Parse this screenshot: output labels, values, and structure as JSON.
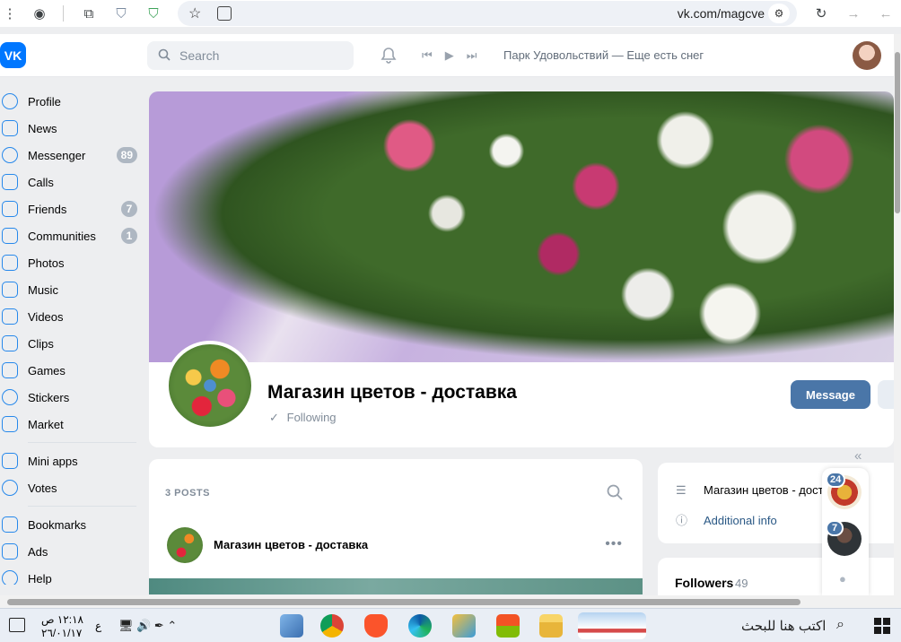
{
  "browser": {
    "url": "vk.com/magcve"
  },
  "header": {
    "logo_text": "VK",
    "search_placeholder": "Search",
    "now_playing": "Парк Удовольствий — Еще есть снег"
  },
  "sidebar": {
    "items": [
      {
        "label": "Profile",
        "icon": "profile-icon",
        "count": ""
      },
      {
        "label": "News",
        "icon": "news-icon",
        "count": ""
      },
      {
        "label": "Messenger",
        "icon": "messenger-icon",
        "count": "89"
      },
      {
        "label": "Calls",
        "icon": "calls-icon",
        "count": ""
      },
      {
        "label": "Friends",
        "icon": "friends-icon",
        "count": "7"
      },
      {
        "label": "Communities",
        "icon": "communities-icon",
        "count": "1"
      },
      {
        "label": "Photos",
        "icon": "photos-icon",
        "count": ""
      },
      {
        "label": "Music",
        "icon": "music-icon",
        "count": ""
      },
      {
        "label": "Videos",
        "icon": "videos-icon",
        "count": ""
      },
      {
        "label": "Clips",
        "icon": "clips-icon",
        "count": ""
      },
      {
        "label": "Games",
        "icon": "games-icon",
        "count": ""
      },
      {
        "label": "Stickers",
        "icon": "stickers-icon",
        "count": ""
      },
      {
        "label": "Market",
        "icon": "market-icon",
        "count": ""
      }
    ],
    "items2": [
      {
        "label": "Mini apps",
        "icon": "mini-apps-icon"
      },
      {
        "label": "Votes",
        "icon": "votes-icon"
      }
    ],
    "items3": [
      {
        "label": "Bookmarks",
        "icon": "bookmarks-icon"
      },
      {
        "label": "Ads",
        "icon": "ads-icon"
      },
      {
        "label": "Help",
        "icon": "help-icon"
      }
    ]
  },
  "page": {
    "title": "Магазин цветов - доставка",
    "following_label": "Following",
    "message_button": "Message"
  },
  "posts": {
    "count_label": "3 POSTS",
    "author": "Магазин цветов - доставка"
  },
  "info": {
    "description": "Магазин цветов - дост",
    "additional_info": "Additional info",
    "followers_label": "Followers",
    "followers_count": "49"
  },
  "chats": {
    "badge1": "24",
    "badge2": "7"
  },
  "taskbar": {
    "time": "١٢:١٨ ص",
    "date": "٢٦/٠١/١٧",
    "lang": "ع",
    "search_text": "اكتب هنا للبحث"
  },
  "colors": {
    "vk_blue": "#0077ff",
    "accent": "#2688eb",
    "message_button": "#4a76a8"
  }
}
